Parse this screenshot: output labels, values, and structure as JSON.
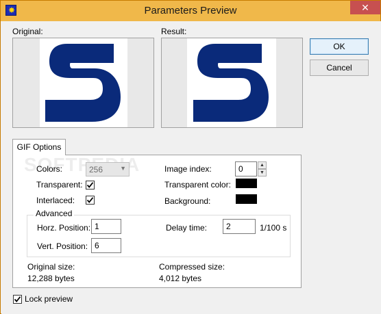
{
  "window": {
    "title": "Parameters Preview",
    "close_glyph": "✕",
    "app_icon": "sun-burst-icon"
  },
  "preview": {
    "original_label": "Original:",
    "result_label": "Result:",
    "letter": "S",
    "letter_color": "#0a2a7a"
  },
  "buttons": {
    "ok": "OK",
    "cancel": "Cancel"
  },
  "tabs": {
    "gif_options": "GIF Options"
  },
  "gif": {
    "colors_label": "Colors:",
    "colors_value": "256",
    "transparent_label": "Transparent:",
    "transparent_checked": true,
    "interlaced_label": "Interlaced:",
    "interlaced_checked": true,
    "image_index_label": "Image index:",
    "image_index_value": "0",
    "transparent_color_label": "Transparent color:",
    "transparent_color": "#000000",
    "background_label": "Background:",
    "background_color": "#000000"
  },
  "advanced": {
    "title": "Advanced",
    "horz_label": "Horz. Position:",
    "horz_value": "1",
    "vert_label": "Vert. Position:",
    "vert_value": "6",
    "delay_label": "Delay time:",
    "delay_value": "2",
    "delay_unit": "1/100 s"
  },
  "sizes": {
    "original_label": "Original size:",
    "original_value": "12,288 bytes",
    "compressed_label": "Compressed size:",
    "compressed_value": "4,012 bytes"
  },
  "lock_preview": {
    "label": "Lock preview",
    "checked": true
  },
  "watermark": "SOFTPEDIA"
}
